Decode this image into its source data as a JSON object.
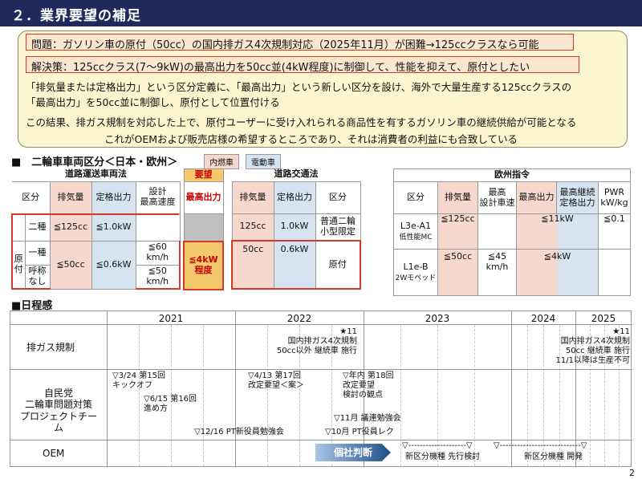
{
  "header": {
    "title": "２．業界要望の補足"
  },
  "summary": {
    "problem": "問題：ガソリン車の原付（50cc）の国内排ガス4次規制対応（2025年11月）が困難→125ccクラスなら可能",
    "solution": "解決策：125ccクラス(7～9kW)の最高出力を50cc並(4kW程度)に制御して、性能を抑えて、原付としたい",
    "line1": "「排気量または定格出力」という区分定義に、「最高出力」という新しい区分を設け、海外で大量生産する125ccクラスの",
    "line2": "「最高出力」を50cc並に制御し、原付として位置付ける",
    "line3": "この結果、排ガス規制を対応した上で、原付ユーザーに受け入れられる商品性を有するガソリン車の継続供給が可能となる",
    "line4": "これがOEMおよび販売店様の希望するところであり、それは消費者の利益にも合致している"
  },
  "classification": {
    "title": "■　二輪車車両区分＜日本・欧州＞",
    "legend_ice": "内燃車",
    "legend_ev": "電動車",
    "road_vehicle_law": "道路運送車両法",
    "request": "要望",
    "road_traffic_law": "道路交通法",
    "eu_directive": "欧州指令",
    "col_category": "区分",
    "col_displacement": "排気量",
    "col_rated_output": "定格出力",
    "col_design_speed": "設計\n最高速度",
    "col_max_output": "最高出力",
    "row_second": "二種",
    "row_first": "一種",
    "row_nickname": "呼称\nなし",
    "row_gentsuki": "原\n付",
    "jp_125cc": "≦125cc",
    "jp_1kw": "≦1.0kW",
    "jp_50cc": "≦50cc",
    "jp_06kw": "≦0.6kW",
    "jp_60kmh": "≦60\nkm/h",
    "jp_50kmh": "≦50\nkm/h",
    "req_4kw": "≦4kW\n程度",
    "rt_125cc": "125cc",
    "rt_1kw": "1.0kW",
    "rt_normal2": "普通二輪\n小型限定",
    "rt_50cc": "50cc",
    "rt_06kw": "0.6kW",
    "rt_gentsuki": "原付",
    "eu_col_speed": "最高\n設計車速",
    "eu_col_max_rated": "最高継続\n定格出力",
    "eu_col_pwr": "PWR\nkW/kg",
    "eu_l3e": "L3e-A1",
    "eu_l3e_sub": "低性能MC",
    "eu_l3e_cc": "≦125cc",
    "eu_l3e_kw": "≦11kW",
    "eu_l3e_pwr": "≦0.1",
    "eu_l1e": "L1e-B",
    "eu_l1e_sub": "2Wモペッド",
    "eu_l1e_cc": "≦50cc",
    "eu_l1e_speed": "≦45\nkm/h",
    "eu_l1e_kw": "≦4kW"
  },
  "schedule": {
    "title": "■日程感",
    "years": [
      "2021",
      "2022",
      "2023",
      "2024",
      "2025"
    ],
    "row_emission": "排ガス規制",
    "row_ldp": "自民党\n二輪車問題対策\nプロジェクトチーム",
    "row_oem": "OEM",
    "em_2022": "★11\n国内排ガス4次規制\n50cc以外 継続車 施行",
    "em_2025": "★11\n国内排ガス4次規制\n50cc 継続車 施行\n11/1以降は生産不可",
    "ev_1": "▽3/24 第15回\nキックオフ",
    "ev_2": "▽6/15 第16回\n進め方",
    "ev_3": "▽12/16 PT新役員勉強会",
    "ev_4": "▽4/13 第17回\n改定要望＜案＞",
    "ev_5": "▽年内 第18回\n改定要望\n検討の観点",
    "ev_6": "▽11月 議連勉強会",
    "ev_7": "▽10月 PT役員レク",
    "oem_btn": "個社判断",
    "oem_1": "▽--------------------▽",
    "oem_1_label": "新区分機種 先行検討",
    "oem_2": "▽----------------------------▽",
    "oem_2_label": "新区分機種 開発"
  },
  "page_number": "2"
}
